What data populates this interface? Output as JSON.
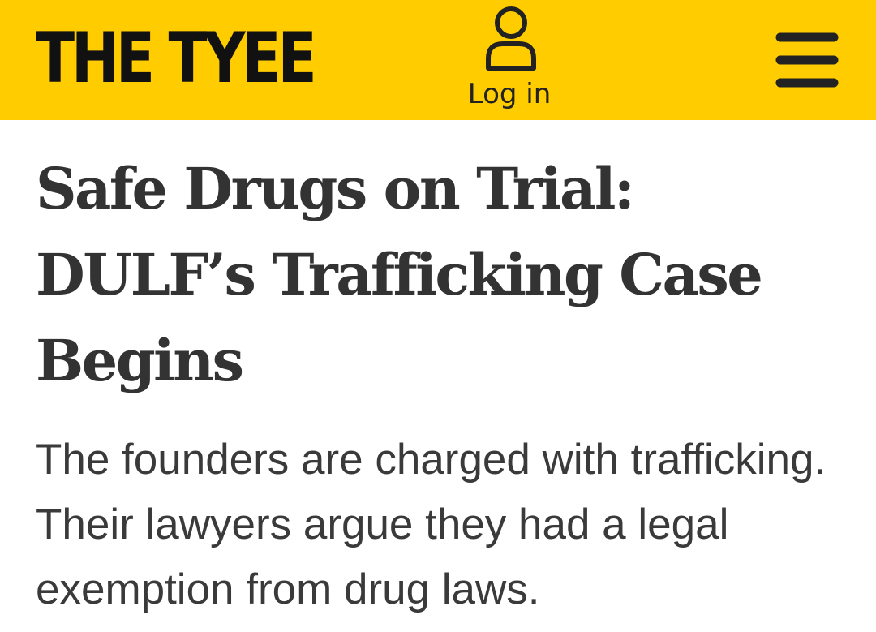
{
  "header": {
    "logo_text": "THE TYEE",
    "login_label": "Log in",
    "login_icon": "user-icon",
    "menu_icon": "hamburger-menu-icon",
    "background_color": "#ffcc00"
  },
  "article": {
    "headline": "Safe Drugs on Trial: DULF’s Trafficking Case Begins",
    "dek": "The founders are charged with trafficking. Their lawyers argue they had a legal exemption from drug laws."
  }
}
